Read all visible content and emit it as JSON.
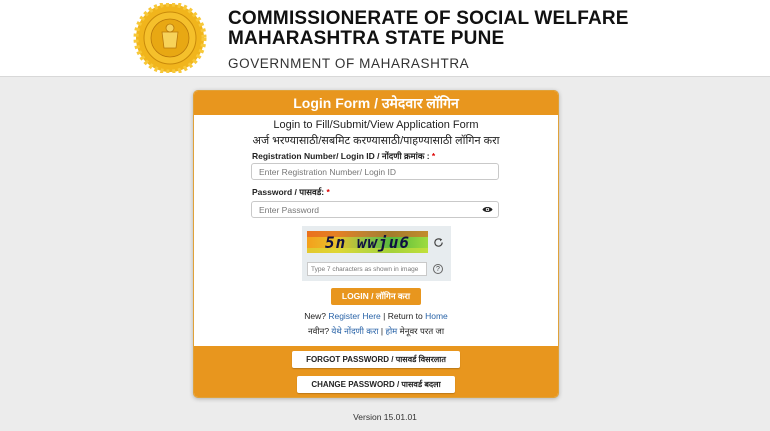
{
  "header": {
    "title_line1": "COMMISSIONERATE OF SOCIAL WELFARE",
    "title_line2": "MAHARASHTRA STATE PUNE",
    "subtitle": "GOVERNMENT OF MAHARASHTRA"
  },
  "form": {
    "heading": "Login Form / उमेदवार लॉगिन",
    "intro_en": "Login to Fill/Submit/View Application Form",
    "intro_mr": "अर्ज भरण्यासाठी/सबमिट करण्यासाठी/पाहण्यासाठी लॉगिन करा",
    "registration_label": "Registration Number/ Login ID / नोंदणी क्रमांक :",
    "registration_placeholder": "Enter Registration Number/ Login ID",
    "password_label": "Password / पासवर्ड:",
    "password_placeholder": "Enter Password",
    "required_mark": "*",
    "captcha_text": "5n wwju6",
    "captcha_placeholder": "Type 7 characters as shown in image",
    "help_symbol": "?",
    "login_button": "LOGIN / लॉगिन करा",
    "new_prefix": "New?",
    "register_link": "Register Here",
    "separator": "|",
    "return_prefix": "Return to",
    "home_link": "Home",
    "new_prefix_mr": "नवीन?",
    "register_link_mr": "येथे नोंदणी करा",
    "home_link_mr": "होम",
    "return_suffix_mr": "मेनूवर परत जा",
    "forgot_button": "FORGOT PASSWORD / पासवर्ड विसरलात",
    "change_button": "CHANGE PASSWORD / पासवर्ड बदला"
  },
  "footer": {
    "version": "Version 15.01.01"
  },
  "colors": {
    "accent": "#e8961e",
    "link": "#2a64a8",
    "required": "#dd0000"
  },
  "icons": [
    "emblem-seal",
    "eye-icon",
    "refresh-icon",
    "help-icon"
  ]
}
